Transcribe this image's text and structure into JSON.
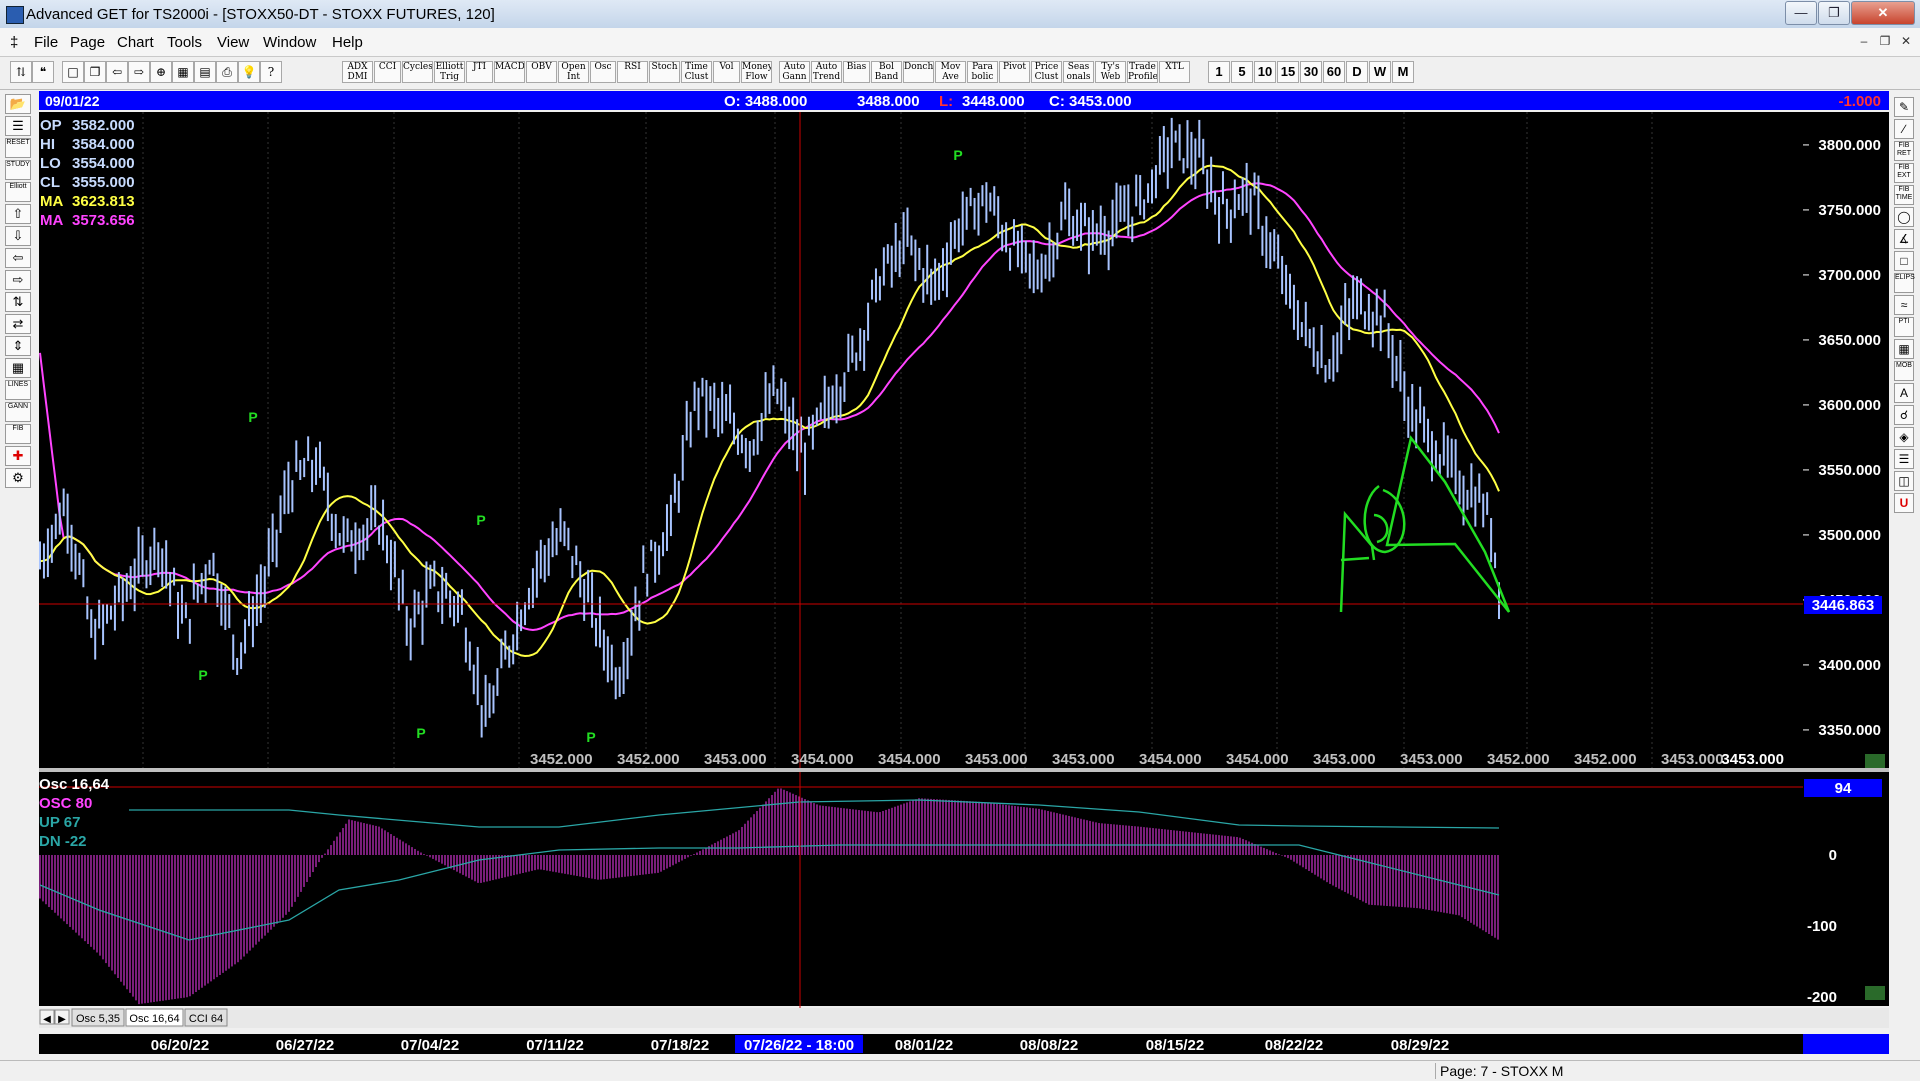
{
  "window": {
    "title": "Advanced GET for TS2000i - [STOXX50-DT - STOXX FUTURES, 120]"
  },
  "menu": [
    "File",
    "Page",
    "Chart",
    "Tools",
    "View",
    "Window",
    "Help"
  ],
  "toolbar": {
    "studies": [
      "ADX DMI",
      "CCI",
      "Cycles",
      "Elliott Trig",
      "JTI",
      "MACD",
      "OBV",
      "Open Int",
      "Osc",
      "RSI",
      "Stoch",
      "Time Clust",
      "Vol",
      "Money Flow",
      "Auto Gann",
      "Auto Trend",
      "Bias",
      "Bol Band",
      "Donch",
      "Mov Ave",
      "Para bolic",
      "Pivot",
      "Price Clust",
      "Seas onals",
      "Ty's Web",
      "Trade Profile",
      "XTL"
    ],
    "intervals": [
      "1",
      "5",
      "10",
      "15",
      "30",
      "60",
      "D",
      "W",
      "M"
    ]
  },
  "left_tools": [
    "RESET",
    "STUDY",
    "Elliott",
    "LINES",
    "GANN",
    "FIB"
  ],
  "right_tools": [
    "FIB RET",
    "FIB EXT",
    "FIB TIME",
    "ELIPS",
    "PTI",
    "MOB"
  ],
  "header": {
    "date": "09/01/22",
    "open": "O: 3488.000",
    "open2": "3488.000",
    "low_label": "L:",
    "low": "3448.000",
    "close": "C: 3453.000",
    "change": "-1.000"
  },
  "legend": [
    {
      "label": "OP",
      "value": "3582.000",
      "color": "#c8dcff"
    },
    {
      "label": "HI",
      "value": "3584.000",
      "color": "#c8dcff"
    },
    {
      "label": "LO",
      "value": "3554.000",
      "color": "#c8dcff"
    },
    {
      "label": "CL",
      "value": "3555.000",
      "color": "#c8dcff"
    },
    {
      "label": "MA",
      "value": "3623.813",
      "color": "#ffff44"
    },
    {
      "label": "MA",
      "value": "3573.656",
      "color": "#ff44ff"
    }
  ],
  "price_axis": [
    "3800.000",
    "3750.000",
    "3700.000",
    "3650.000",
    "3600.000",
    "3550.000",
    "3500.000",
    "3450.000",
    "3400.000",
    "3350.000"
  ],
  "current_price": "3446.863",
  "pivot_label": "P",
  "bottom_values": [
    "3452.000",
    "3452.000",
    "3453.000",
    "3454.000",
    "3454.000",
    "3453.000",
    "3453.000",
    "3454.000",
    "3454.000",
    "3453.000",
    "3453.000",
    "3452.000",
    "3452.000",
    "3453.000",
    "3453.000"
  ],
  "osc": {
    "title": "Osc 16,64",
    "osc_label": "OSC 80",
    "up_label": "UP  67",
    "dn_label": "DN  -22",
    "axis": [
      "0",
      "-100",
      "-200"
    ],
    "top_value": "94"
  },
  "tabs": [
    "Osc 5,35",
    "Osc 16,64",
    "CCI 64"
  ],
  "date_axis": [
    "06/20/22",
    "06/27/22",
    "07/04/22",
    "07/11/22",
    "07/18/22",
    "07/26/22 - 18:00",
    "08/01/22",
    "08/08/22",
    "08/15/22",
    "08/22/22",
    "08/29/22"
  ],
  "status": "Page: 7 - STOXX M",
  "colors": {
    "bar": "#a8c4ff",
    "ma_fast": "#ffff44",
    "ma_slow": "#ff44ff",
    "pivot": "#22dd22",
    "header_bg": "#0000ff",
    "drawing": "#22dd22",
    "osc_bar": "#cc33cc",
    "osc_line": "#2aa6a6",
    "cursor": "#cc0000"
  }
}
